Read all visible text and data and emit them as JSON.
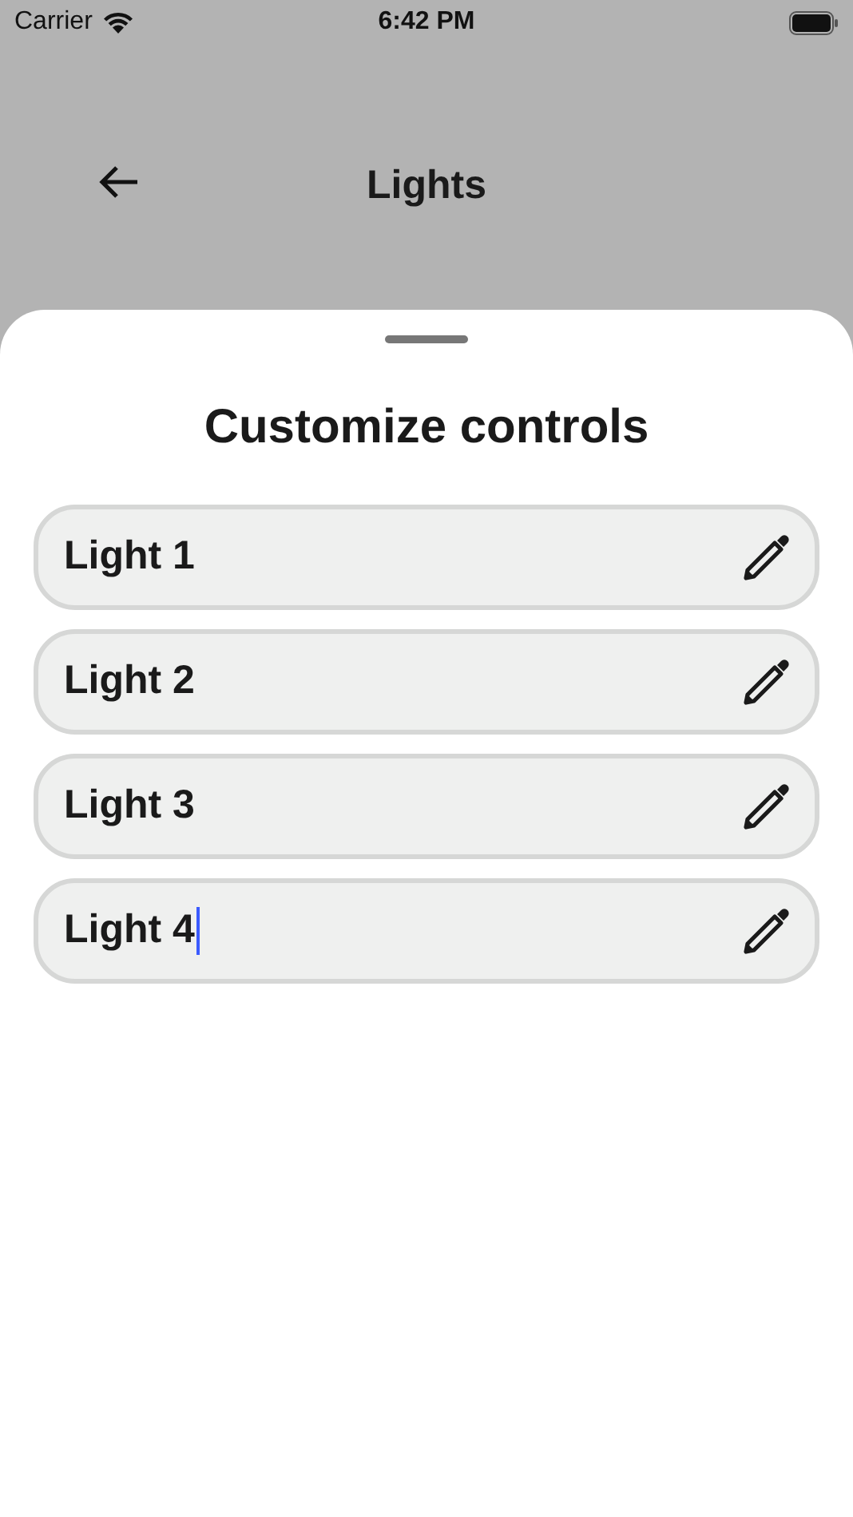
{
  "status_bar": {
    "carrier": "Carrier",
    "time": "6:42 PM"
  },
  "nav": {
    "title": "Lights"
  },
  "sheet": {
    "title": "Customize controls",
    "fields": [
      {
        "value": "Light 1",
        "focused": false
      },
      {
        "value": "Light 2",
        "focused": false
      },
      {
        "value": "Light 3",
        "focused": false
      },
      {
        "value": "Light 4",
        "focused": true
      }
    ]
  }
}
